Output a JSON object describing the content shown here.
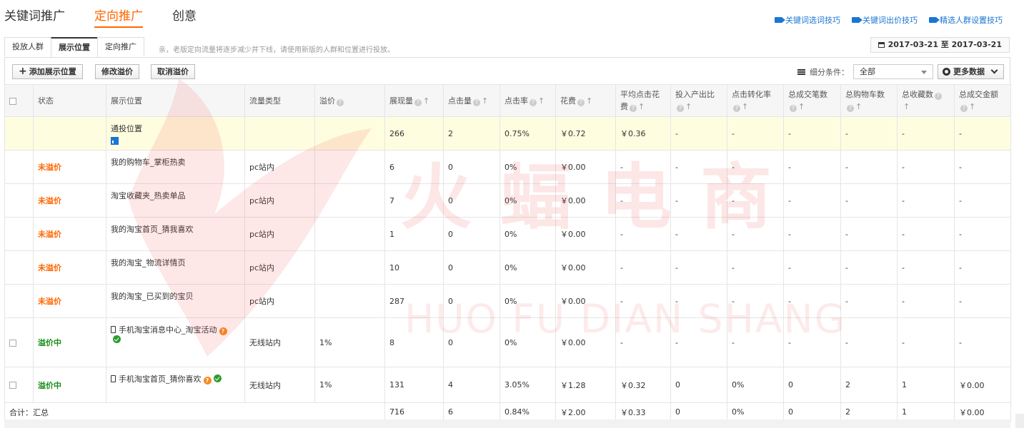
{
  "top_tabs": [
    {
      "label": "关键词推广",
      "active": false
    },
    {
      "label": "定向推广",
      "active": true
    },
    {
      "label": "创意",
      "active": false
    }
  ],
  "tips": [
    {
      "label": "关键词选词技巧",
      "icon": "video-icon"
    },
    {
      "label": "关键词出价技巧",
      "icon": "video-icon"
    },
    {
      "label": "精选人群设置技巧",
      "icon": "video-icon"
    }
  ],
  "sub_tabs": [
    {
      "label": "投放人群",
      "active": false
    },
    {
      "label": "展示位置",
      "active": true
    },
    {
      "label": "定向推广",
      "active": false
    }
  ],
  "notice": "亲，老版定向流量将逐步减少并下线，请使用新版的人群和位置进行投放。",
  "date_range": "2017-03-21 至 2017-03-21",
  "toolbar": {
    "add_label": "添加展示位置",
    "modify_label": "修改溢价",
    "cancel_label": "取消溢价",
    "filter_label": "细分条件：",
    "filter_value": "全部",
    "more_label": "更多数据"
  },
  "columns": [
    "状态",
    "展示位置",
    "流量类型",
    "溢价",
    "展现量",
    "点击量",
    "点击率",
    "花费",
    "平均点击花费",
    "投入产出比",
    "点击转化率",
    "总成交笔数",
    "总购物车数",
    "总收藏数",
    "总成交金额"
  ],
  "rows": [
    {
      "status": "",
      "position": "通投位置",
      "traffic": "",
      "premium": "",
      "impressions": "266",
      "clicks": "2",
      "ctr": "0.75%",
      "cost": "￥0.72",
      "cpc": "￥0.36",
      "roi": "-",
      "cvr": "-",
      "orders": "-",
      "carts": "-",
      "favs": "-",
      "gmv": "-"
    },
    {
      "status": "未溢价",
      "position": "我的购物车_掌柜热卖",
      "traffic": "pc站内",
      "premium": "",
      "impressions": "6",
      "clicks": "0",
      "ctr": "0%",
      "cost": "￥0.00",
      "cpc": "-",
      "roi": "-",
      "cvr": "-",
      "orders": "-",
      "carts": "-",
      "favs": "-",
      "gmv": "-"
    },
    {
      "status": "未溢价",
      "position": "淘宝收藏夹_热卖单品",
      "traffic": "pc站内",
      "premium": "",
      "impressions": "7",
      "clicks": "0",
      "ctr": "0%",
      "cost": "￥0.00",
      "cpc": "-",
      "roi": "-",
      "cvr": "-",
      "orders": "-",
      "carts": "-",
      "favs": "-",
      "gmv": "-"
    },
    {
      "status": "未溢价",
      "position": "我的淘宝首页_猜我喜欢",
      "traffic": "pc站内",
      "premium": "",
      "impressions": "1",
      "clicks": "0",
      "ctr": "0%",
      "cost": "￥0.00",
      "cpc": "-",
      "roi": "-",
      "cvr": "-",
      "orders": "-",
      "carts": "-",
      "favs": "-",
      "gmv": "-"
    },
    {
      "status": "未溢价",
      "position": "我的淘宝_物流详情页",
      "traffic": "pc站内",
      "premium": "",
      "impressions": "10",
      "clicks": "0",
      "ctr": "0%",
      "cost": "￥0.00",
      "cpc": "-",
      "roi": "-",
      "cvr": "-",
      "orders": "-",
      "carts": "-",
      "favs": "-",
      "gmv": "-"
    },
    {
      "status": "未溢价",
      "position": "我的淘宝_已买到的宝贝",
      "traffic": "pc站内",
      "premium": "",
      "impressions": "287",
      "clicks": "0",
      "ctr": "0%",
      "cost": "￥0.00",
      "cpc": "-",
      "roi": "-",
      "cvr": "-",
      "orders": "-",
      "carts": "-",
      "favs": "-",
      "gmv": "-"
    },
    {
      "status": "溢价中",
      "position": "手机淘宝消息中心_淘宝活动",
      "traffic": "无线站内",
      "premium": "1%",
      "impressions": "8",
      "clicks": "0",
      "ctr": "0%",
      "cost": "￥0.00",
      "cpc": "-",
      "roi": "-",
      "cvr": "-",
      "orders": "-",
      "carts": "-",
      "favs": "-",
      "gmv": "-"
    },
    {
      "status": "溢价中",
      "position": "手机淘宝首页_猜你喜欢",
      "traffic": "无线站内",
      "premium": "1%",
      "impressions": "131",
      "clicks": "4",
      "ctr": "3.05%",
      "cost": "￥1.28",
      "cpc": "￥0.32",
      "roi": "0",
      "cvr": "0%",
      "orders": "0",
      "carts": "2",
      "favs": "1",
      "gmv": "￥0.00"
    }
  ],
  "summary": {
    "label": "合计：汇总",
    "impressions": "716",
    "clicks": "6",
    "ctr": "0.84%",
    "cost": "￥2.00",
    "cpc": "￥0.33",
    "roi": "0",
    "cvr": "0%",
    "orders": "0",
    "carts": "2",
    "favs": "1",
    "gmv": "￥0.00"
  },
  "watermark": {
    "main": "火蝠电商",
    "sub": "HUO FU DIAN SHANG"
  },
  "colors": {
    "accent": "#ff6600",
    "link": "#1976d2",
    "status_on": "#1b8e1b",
    "status_none": "#ff6600",
    "highlight_row": "#fffde0"
  }
}
